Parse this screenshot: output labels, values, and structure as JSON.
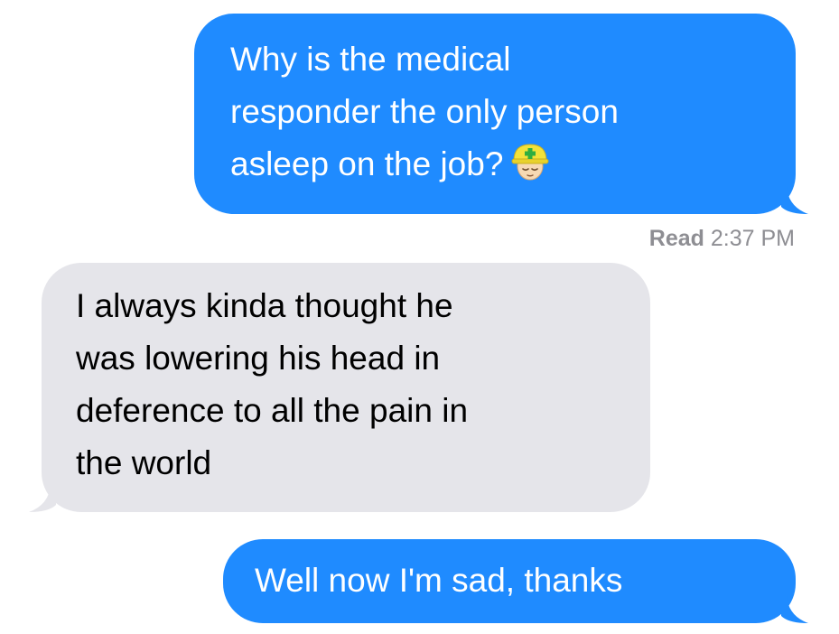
{
  "conversation": {
    "messages": [
      {
        "sender": "me",
        "lines": [
          "Why is the medical",
          "responder the only person",
          "asleep on the job?"
        ],
        "emoji": "sleeping-medic-emoji"
      },
      {
        "sender": "them",
        "lines": [
          "I always kinda thought he",
          "was lowering his head in",
          "deference to all the pain in",
          "the world"
        ]
      },
      {
        "sender": "me",
        "lines": [
          "Well now I'm sad, thanks"
        ]
      }
    ],
    "read_receipt": {
      "label": "Read",
      "time": "2:37 PM"
    }
  },
  "colors": {
    "sent_bubble": "#1f8bff",
    "received_bubble": "#e5e5ea",
    "receipt_text": "#8e8e93"
  }
}
